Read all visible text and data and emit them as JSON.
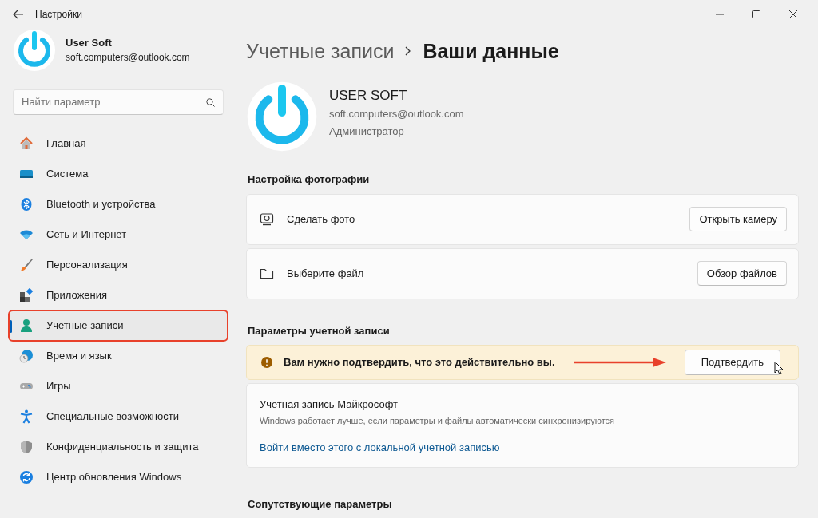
{
  "window": {
    "title": "Настройки"
  },
  "sidebar": {
    "user": {
      "name": "User Soft",
      "email": "soft.computers@outlook.com"
    },
    "search": {
      "placeholder": "Найти параметр"
    },
    "items": [
      {
        "label": "Главная",
        "kind": "home",
        "selected": false,
        "highlighted": false
      },
      {
        "label": "Система",
        "kind": "system",
        "selected": false,
        "highlighted": false
      },
      {
        "label": "Bluetooth и устройства",
        "kind": "bluetooth",
        "selected": false,
        "highlighted": false
      },
      {
        "label": "Сеть и Интернет",
        "kind": "network",
        "selected": false,
        "highlighted": false
      },
      {
        "label": "Персонализация",
        "kind": "brush",
        "selected": false,
        "highlighted": false
      },
      {
        "label": "Приложения",
        "kind": "apps",
        "selected": false,
        "highlighted": false
      },
      {
        "label": "Учетные записи",
        "kind": "accounts",
        "selected": true,
        "highlighted": true
      },
      {
        "label": "Время и язык",
        "kind": "time",
        "selected": false,
        "highlighted": false
      },
      {
        "label": "Игры",
        "kind": "games",
        "selected": false,
        "highlighted": false
      },
      {
        "label": "Специальные возможности",
        "kind": "accessibility",
        "selected": false,
        "highlighted": false
      },
      {
        "label": "Конфиденциальность и защита",
        "kind": "privacy",
        "selected": false,
        "highlighted": false
      },
      {
        "label": "Центр обновления Windows",
        "kind": "update",
        "selected": false,
        "highlighted": false
      }
    ]
  },
  "breadcrumb": [
    "Учетные записи",
    "Ваши данные"
  ],
  "profile": {
    "name": "USER SOFT",
    "email": "soft.computers@outlook.com",
    "role": "Администратор"
  },
  "photo_section": {
    "title": "Настройка фотографии",
    "rows": [
      {
        "kind": "camera",
        "label": "Сделать фото",
        "button": "Открыть камеру"
      },
      {
        "kind": "folder",
        "label": "Выберите файл",
        "button": "Обзор файлов"
      }
    ]
  },
  "account_section": {
    "title": "Параметры учетной записи",
    "banner": {
      "text": "Вам нужно подтвердить, что это действительно вы.",
      "button": "Подтвердить",
      "annotation_arrow": true
    },
    "microsoft_account": {
      "title": "Учетная запись Майкрософт",
      "description": "Windows работает лучше, если параметры и файлы автоматически синхронизируются",
      "link": "Войти вместо этого с локальной учетной записью"
    }
  },
  "related_section": {
    "title": "Сопутствующие параметры"
  }
}
